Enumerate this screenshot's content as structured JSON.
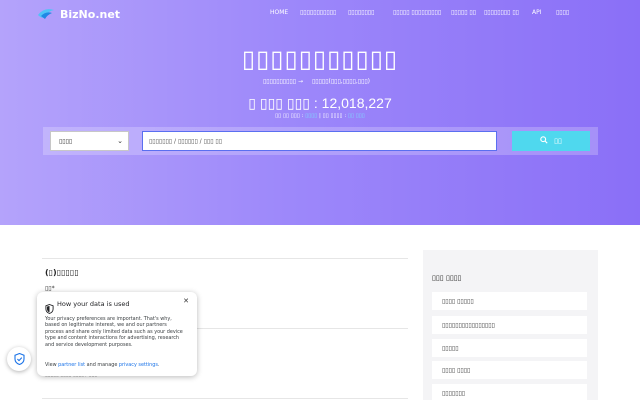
{
  "brand": {
    "name": "BizNo.net"
  },
  "nav": {
    "items": [
      "HOME",
      "▯▯▯▯▯▯▯▯▯▯▯",
      "▯▯▯▯▯▯▯▯",
      "▯▯▯▯▯ ▯▯▯▯▯▯▯▯▯",
      "▯▯▯▯▯ ▯▯",
      "▯▯▯▯▯▯▯▯ ▯▯",
      "API",
      "▯▯▯▯"
    ]
  },
  "hero": {
    "title": "▯▯▯▯▯▯▯▯▯▯▯",
    "path_from": "▯▯▯▯▯▯▯▯▯▯",
    "path_arrow": "→",
    "path_to": "▯▯▯▯▯(▯▯▯,▯▯▯▯,▯▯▯)",
    "count_label": "▯ ▯▯▯ ▯▯▯ : ",
    "count_value": "12,018,227",
    "sub_a_label": "▯▯ ▯▯ ▯▯▯ : ",
    "sub_a_value": "▯▯▯▯",
    "sub_sep": " | ",
    "sub_b_label": "▯▯ ▯▯▯▯ : ",
    "sub_b_value": "▯▯ ▯▯▯"
  },
  "search": {
    "select_value": "▯▯▯▯",
    "placeholder": "▯▯▯▯▯▯▯ / ▯▯▯▯▯▯ / ▯▯▯ ▯▯",
    "button_label": "▯▯"
  },
  "results": {
    "company_name": "(▯)▯▯▯▯▯",
    "company_sub": "▯▯*",
    "row_text": "▯▯▯▯▯ ▯▯▯▯ ▯▯▯▯ / ▯▯▯ 2"
  },
  "sidebar": {
    "title": "▯▯▯ ▯▯▯▯",
    "items": [
      "▯▯▯▯ ▯▯▯▯▯",
      "▯▯▯▯▯▯▯▯▯▯▯▯▯▯▯▯",
      "▯▯▯▯▯",
      "▯▯▯▯ ▯▯▯▯",
      "▯▯▯▯▯▯▯"
    ]
  },
  "privacy": {
    "title": "How your data is used",
    "body": "Your privacy preferences are important. That's why, based on legitimate interest, we and our partners process and share only limited data such as your device type and content interactions for advertising, research and service development purposes.",
    "foot_prefix": "View ",
    "partner_link": "partner list",
    "foot_mid": " and manage ",
    "settings_link": "privacy settings",
    "foot_suffix": "."
  },
  "colors": {
    "hero_start": "#b4a3fb",
    "hero_end": "#8a6ff7",
    "button": "#4fd8ee",
    "link": "#1a73e8"
  }
}
